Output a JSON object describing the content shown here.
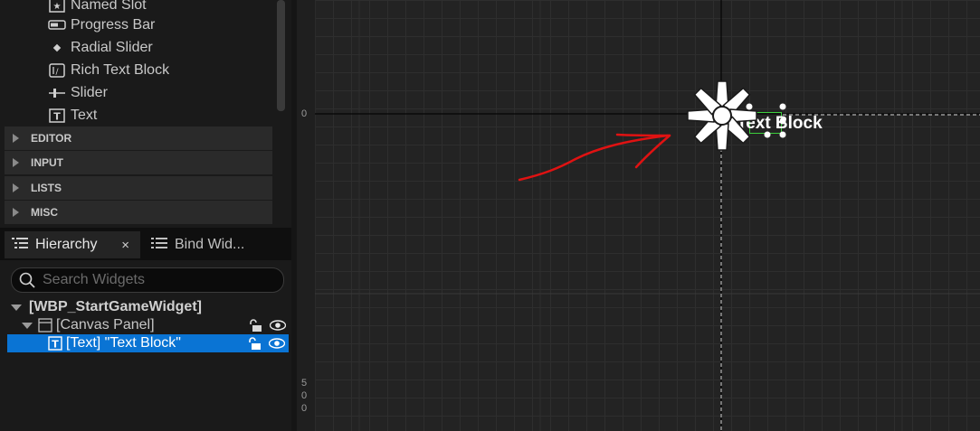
{
  "palette": {
    "items": [
      {
        "label": "Named Slot",
        "icon": "named-slot-icon"
      },
      {
        "label": "Progress Bar",
        "icon": "progress-bar-icon"
      },
      {
        "label": "Radial Slider",
        "icon": "radial-slider-icon"
      },
      {
        "label": "Rich Text Block",
        "icon": "rich-text-icon"
      },
      {
        "label": "Slider",
        "icon": "slider-icon"
      },
      {
        "label": "Text",
        "icon": "text-icon"
      }
    ],
    "categories": [
      "EDITOR",
      "INPUT",
      "LISTS",
      "MISC"
    ]
  },
  "tabs": {
    "hierarchy": "Hierarchy",
    "bind": "Bind Wid...",
    "close": "×"
  },
  "search": {
    "placeholder": "Search Widgets"
  },
  "hierarchy": {
    "root": "[WBP_StartGameWidget]",
    "canvas": "[Canvas Panel]",
    "text": "[Text] \"Text Block\""
  },
  "canvas": {
    "ruler_top": "0",
    "ruler_bottom": [
      "5",
      "0",
      "0"
    ],
    "widget_text": "Text Block"
  },
  "colors": {
    "selection": "#0a74d4",
    "annotation": "#e01212",
    "widget_outline": "#3ccf3c"
  }
}
